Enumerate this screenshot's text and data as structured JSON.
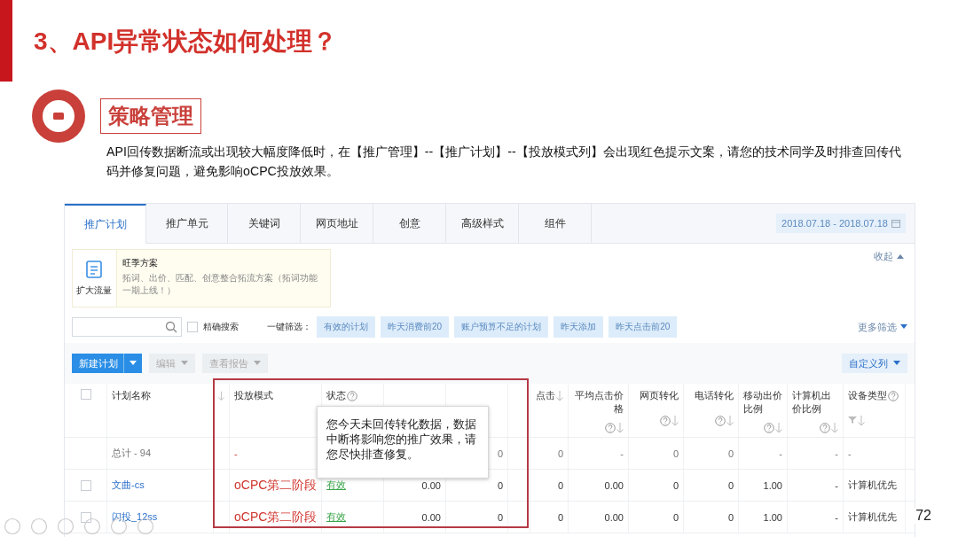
{
  "slide": {
    "title": "3、API异常状态如何处理？",
    "section_label": "策略管理",
    "paragraph": "API回传数据断流或出现较大幅度降低时，在【推广管理】--【推广计划】--【投放模式列】会出现红色提示文案，请您的技术同学及时排查回传代码并修复问题，避免影响oCPC投放效果。",
    "page_number": "72"
  },
  "tabs": [
    {
      "label": "推广计划",
      "selected": true
    },
    {
      "label": "推广单元",
      "selected": false
    },
    {
      "label": "关键词",
      "selected": false
    },
    {
      "label": "网页地址",
      "selected": false
    },
    {
      "label": "创意",
      "selected": false
    },
    {
      "label": "高级样式",
      "selected": false
    },
    {
      "label": "组件",
      "selected": false
    }
  ],
  "date_range": "2018.07.18 - 2018.07.18",
  "promo": {
    "icon_label": "扩大流量",
    "title": "旺季方案",
    "text": "拓词、出价、匹配、创意整合拓流方案（拓词功能一期上线！）",
    "collapse": "收起"
  },
  "filter_bar": {
    "precise_search": {
      "label": "精确搜索",
      "checked": false
    },
    "quick_label": "一键筛选：",
    "chips": [
      "有效的计划",
      "昨天消费前20",
      "账户预算不足的计划",
      "昨天添加",
      "昨天点击前20"
    ],
    "more": "更多筛选"
  },
  "actions": [
    {
      "label": "新建计划",
      "kind": "primary"
    },
    {
      "label": "编辑",
      "kind": "disabled"
    },
    {
      "label": "查看报告",
      "kind": "disabled"
    }
  ],
  "custom_columns": "自定义列",
  "select_all_checked": false,
  "columns": [
    {
      "label": "计划名称",
      "help": false,
      "sort": false,
      "filter": false
    },
    {
      "help": false,
      "sort": true,
      "filter": false
    },
    {
      "label": "投放模式",
      "help": false,
      "sort": false,
      "filter": false
    },
    {
      "label": "状态",
      "help": true,
      "sort": false,
      "filter": false
    },
    {
      "help": false,
      "sort": false,
      "filter": false
    },
    {
      "help": false,
      "sort": false,
      "filter": false
    },
    {
      "help": false,
      "sort": false,
      "filter": false
    },
    {
      "label": "点击",
      "help": false,
      "sort": true,
      "filter": false
    },
    {
      "label": "平均点击价格",
      "help": true,
      "sort": true,
      "filter": false
    },
    {
      "label": "网页转化",
      "help": true,
      "sort": true,
      "filter": false
    },
    {
      "label": "电话转化",
      "help": true,
      "sort": true,
      "filter": false
    },
    {
      "label": "移动出价比例",
      "help": true,
      "sort": true,
      "filter": false
    },
    {
      "label": "计算机出价比例",
      "help": true,
      "sort": true,
      "filter": false
    },
    {
      "label": "设备类型",
      "help": true,
      "sort": true,
      "filter": true
    }
  ],
  "rows": [
    {
      "kind": "total",
      "cells": [
        "总计 - 94",
        null,
        "-",
        null,
        null,
        "0",
        null,
        "0",
        "-",
        "0",
        "0",
        "-",
        "-",
        "-"
      ]
    },
    {
      "kind": "plan",
      "checked": false,
      "cells": [
        "文曲-cs",
        null,
        "oCPC第二阶段",
        "有效",
        "0.00",
        "0",
        null,
        "0",
        "0.00",
        "0",
        "0",
        "1.00",
        "-",
        "计算机优先"
      ]
    },
    {
      "kind": "plan",
      "checked": false,
      "cells": [
        "闪投_12ss",
        null,
        "oCPC第二阶段",
        "有效",
        "0.00",
        "0",
        null,
        "0",
        "0.00",
        "0",
        "0",
        "1.00",
        "-",
        "计算机优先"
      ]
    }
  ],
  "tooltip": "您今天未回传转化数据，数据中断将影响您的推广效果，请您尽快排查修复。"
}
